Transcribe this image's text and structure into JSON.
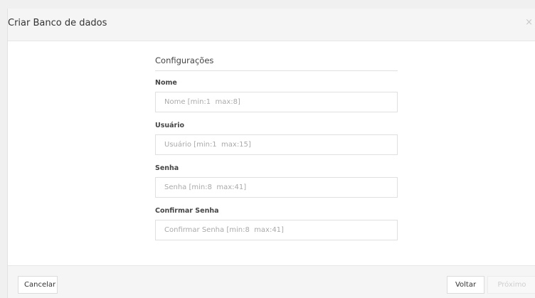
{
  "dialog": {
    "title": "Criar Banco de dados",
    "close_glyph": "×"
  },
  "form": {
    "section_title": "Configurações",
    "fields": [
      {
        "label": "Nome",
        "placeholder": "Nome [min:1  max:8]",
        "value": ""
      },
      {
        "label": "Usuário",
        "placeholder": "Usuário [min:1  max:15]",
        "value": ""
      },
      {
        "label": "Senha",
        "placeholder": "Senha [min:8  max:41]",
        "value": ""
      },
      {
        "label": "Confirmar Senha",
        "placeholder": "Confirmar Senha [min:8  max:41]",
        "value": ""
      }
    ]
  },
  "footer": {
    "cancel_label": "Cancelar",
    "back_label": "Voltar",
    "next_label": "Próximo",
    "next_disabled": true
  }
}
